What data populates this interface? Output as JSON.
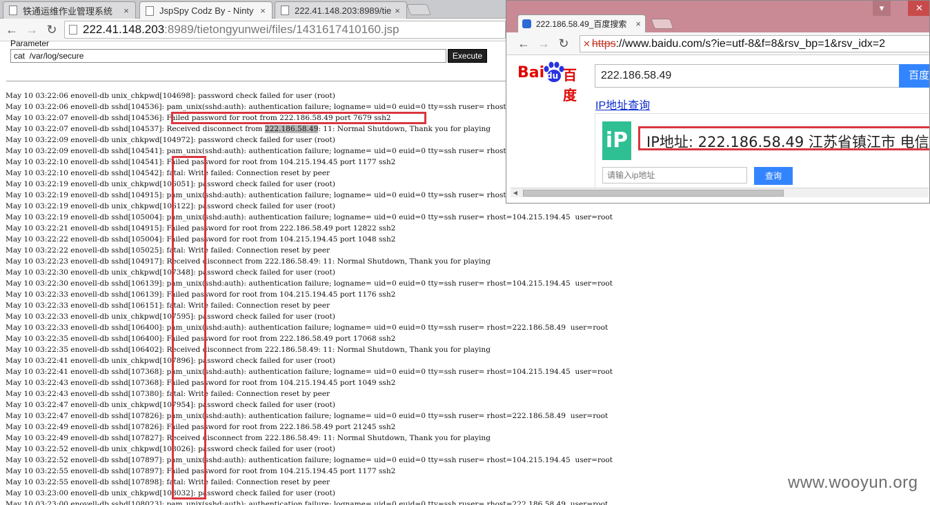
{
  "browser": {
    "tabs": [
      {
        "title": "铁通运维作业管理系统",
        "active": false
      },
      {
        "title": "JspSpy Codz By - Ninty",
        "active": true
      },
      {
        "title": "222.41.148.203:8989/tie",
        "active": false
      }
    ],
    "tab_close_glyph": "×",
    "url_host": "222.41.148.203",
    "url_path": ":8989/tietongyunwei/files/1431617410160.jsp"
  },
  "page": {
    "parameter_label": "Parameter",
    "command_value": "cat  /var/log/secure",
    "execute_label": "Execute"
  },
  "log": [
    "May 10 03:22:06 enovell-db unix_chkpwd[104698]: password check failed for user (root)",
    "May 10 03:22:06 enovell-db sshd[104536]: pam_unix(sshd:auth): authentication failure; logname= uid=0 euid=0 tty=ssh ruser= rhost=222.186.58.49  user=root",
    "May 10 03:22:07 enovell-db sshd[104536]: Failed password for root from 222.186.58.49 port 7679 ssh2",
    "May 10 03:22:07 enovell-db sshd[104537]: Received disconnect from 222.186.58.49: 11: Normal Shutdown, Thank you for playing",
    "May 10 03:22:09 enovell-db unix_chkpwd[104972]: password check failed for user (root)",
    "May 10 03:22:09 enovell-db sshd[104541]: pam_unix(sshd:auth): authentication failure; logname= uid=0 euid=0 tty=ssh ruser= rhost=104.215.194.45  user=root",
    "May 10 03:22:10 enovell-db sshd[104541]: Failed password for root from 104.215.194.45 port 1177 ssh2",
    "May 10 03:22:10 enovell-db sshd[104542]: fatal: Write failed: Connection reset by peer",
    "May 10 03:22:19 enovell-db unix_chkpwd[106051]: password check failed for user (root)",
    "May 10 03:22:19 enovell-db sshd[104915]: pam_unix(sshd:auth): authentication failure; logname= uid=0 euid=0 tty=ssh ruser= rhost=222.186.58.49  user=root",
    "May 10 03:22:19 enovell-db unix_chkpwd[106122]: password check failed for user (root)",
    "May 10 03:22:19 enovell-db sshd[105004]: pam_unix(sshd:auth): authentication failure; logname= uid=0 euid=0 tty=ssh ruser= rhost=104.215.194.45  user=root",
    "May 10 03:22:21 enovell-db sshd[104915]: Failed password for root from 222.186.58.49 port 12822 ssh2",
    "May 10 03:22:22 enovell-db sshd[105004]: Failed password for root from 104.215.194.45 port 1048 ssh2",
    "May 10 03:22:22 enovell-db sshd[105025]: fatal: Write failed: Connection reset by peer",
    "May 10 03:22:23 enovell-db sshd[104917]: Received disconnect from 222.186.58.49: 11: Normal Shutdown, Thank you for playing",
    "May 10 03:22:30 enovell-db unix_chkpwd[107348]: password check failed for user (root)",
    "May 10 03:22:30 enovell-db sshd[106139]: pam_unix(sshd:auth): authentication failure; logname= uid=0 euid=0 tty=ssh ruser= rhost=104.215.194.45  user=root",
    "May 10 03:22:33 enovell-db sshd[106139]: Failed password for root from 104.215.194.45 port 1176 ssh2",
    "May 10 03:22:33 enovell-db sshd[106151]: fatal: Write failed: Connection reset by peer",
    "May 10 03:22:33 enovell-db unix_chkpwd[107595]: password check failed for user (root)",
    "May 10 03:22:33 enovell-db sshd[106400]: pam_unix(sshd:auth): authentication failure; logname= uid=0 euid=0 tty=ssh ruser= rhost=222.186.58.49  user=root",
    "May 10 03:22:35 enovell-db sshd[106400]: Failed password for root from 222.186.58.49 port 17068 ssh2",
    "May 10 03:22:35 enovell-db sshd[106402]: Received disconnect from 222.186.58.49: 11: Normal Shutdown, Thank you for playing",
    "May 10 03:22:41 enovell-db unix_chkpwd[107896]: password check failed for user (root)",
    "May 10 03:22:41 enovell-db sshd[107368]: pam_unix(sshd:auth): authentication failure; logname= uid=0 euid=0 tty=ssh ruser= rhost=104.215.194.45  user=root",
    "May 10 03:22:43 enovell-db sshd[107368]: Failed password for root from 104.215.194.45 port 1049 ssh2",
    "May 10 03:22:43 enovell-db sshd[107380]: fatal: Write failed: Connection reset by peer",
    "May 10 03:22:47 enovell-db unix_chkpwd[107954]: password check failed for user (root)",
    "May 10 03:22:47 enovell-db sshd[107826]: pam_unix(sshd:auth): authentication failure; logname= uid=0 euid=0 tty=ssh ruser= rhost=222.186.58.49  user=root",
    "May 10 03:22:49 enovell-db sshd[107826]: Failed password for root from 222.186.58.49 port 21245 ssh2",
    "May 10 03:22:49 enovell-db sshd[107827]: Received disconnect from 222.186.58.49: 11: Normal Shutdown, Thank you for playing",
    "May 10 03:22:52 enovell-db unix_chkpwd[108026]: password check failed for user (root)",
    "May 10 03:22:52 enovell-db sshd[107897]: pam_unix(sshd:auth): authentication failure; logname= uid=0 euid=0 tty=ssh ruser= rhost=104.215.194.45  user=root",
    "May 10 03:22:55 enovell-db sshd[107897]: Failed password for root from 104.215.194.45 port 1177 ssh2",
    "May 10 03:22:55 enovell-db sshd[107898]: fatal: Write failed: Connection reset by peer",
    "May 10 03:23:00 enovell-db unix_chkpwd[108032]: password check failed for user (root)",
    "May 10 03:23:00 enovell-db sshd[108023]: pam_unix(sshd:auth): authentication failure; logname= uid=0 euid=0 tty=ssh ruser= rhost=222.186.58.49  user=root"
  ],
  "selected_ip": "222.186.58.49",
  "popup": {
    "tab_title": "222.186.58.49_百度搜索",
    "tab_close_glyph": "×",
    "url_scheme": "https",
    "url_rest": "://www.baidu.com/s?ie=utf-8&f=8&rsv_bp=1&rsv_idx=2",
    "logo_left": "Bai",
    "logo_du": "du",
    "logo_right": "百度",
    "search_query": "222.186.58.49",
    "search_button": "百度",
    "ip_lookup_link": "IP地址查询",
    "ip_icon": "iP",
    "ip_result": "IP地址: 222.186.58.49  江苏省镇江市 电信",
    "ip_input_placeholder": "请输入ip地址",
    "ip_query_button": "查询"
  },
  "watermark": "www.wooyun.org",
  "colors": {
    "highlight_box": "#d9363e",
    "baidu_red": "#e10602",
    "baidu_blue": "#3385ff",
    "popup_frame": "#c98a95",
    "ip_green": "#2ebf93"
  }
}
